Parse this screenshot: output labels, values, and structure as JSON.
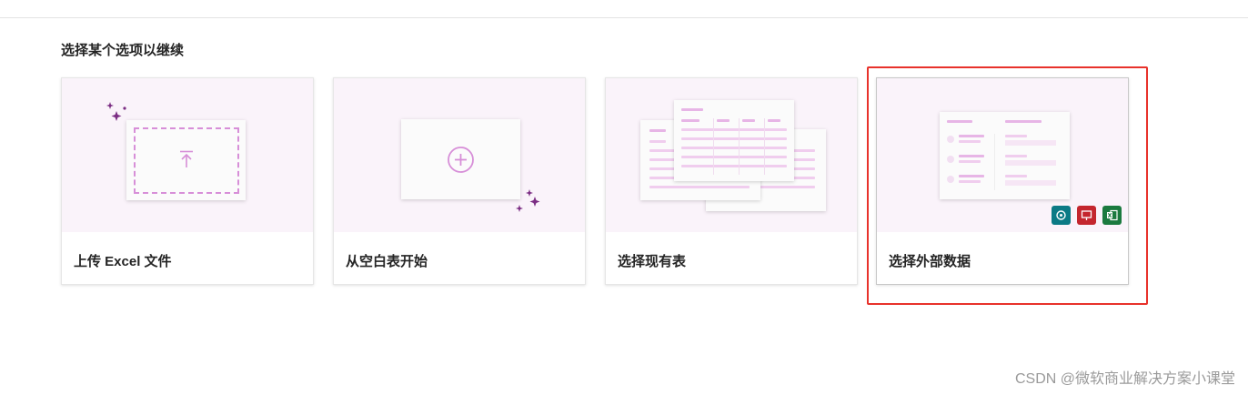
{
  "heading": "选择某个选项以继续",
  "cards": [
    {
      "label": "上传 Excel 文件"
    },
    {
      "label": "从空白表开始"
    },
    {
      "label": "选择现有表"
    },
    {
      "label": "选择外部数据"
    }
  ],
  "colors": {
    "accent": "#d78fd8",
    "sparkle": "#7b2d83",
    "highlight": "#e8322b",
    "badge_teal": "#0b7a85",
    "badge_red": "#c4262e",
    "badge_green": "#1b7a3f"
  },
  "icons": {
    "upload": "upload-arrow-icon",
    "add": "plus-circle-icon",
    "sparkle": "sparkle-icon",
    "badges": [
      "dataverse-icon",
      "powerpoint-icon",
      "excel-icon"
    ]
  },
  "watermark": "CSDN @微软商业解决方案小课堂"
}
